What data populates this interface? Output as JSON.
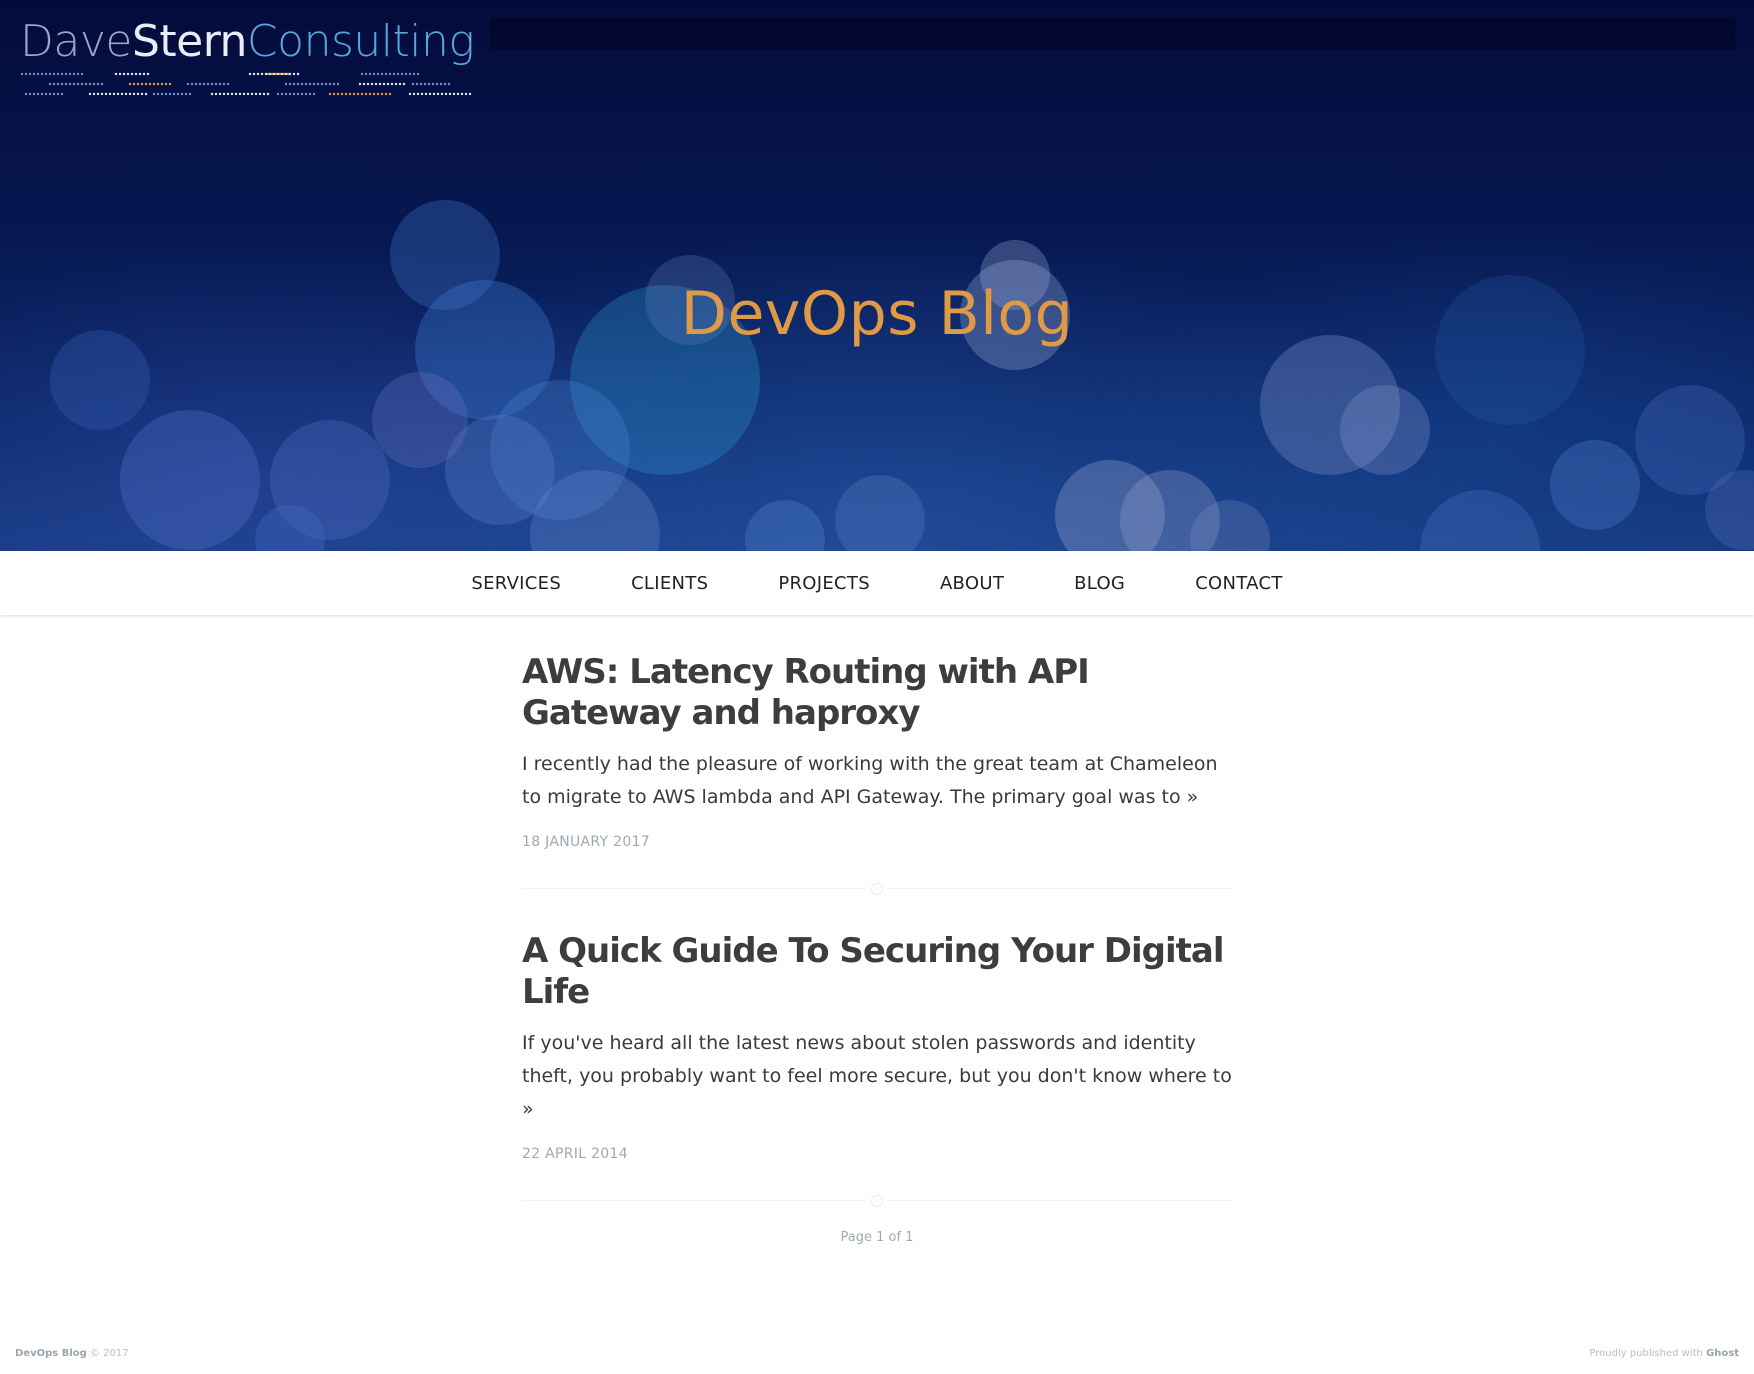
{
  "logo": {
    "first": "Dave",
    "last": "Stern",
    "business": "Consulting"
  },
  "hero": {
    "title": "DevOps Blog"
  },
  "nav": {
    "items": [
      "SERVICES",
      "CLIENTS",
      "PROJECTS",
      "ABOUT",
      "BLOG",
      "CONTACT"
    ]
  },
  "posts": [
    {
      "title": "AWS: Latency Routing with API Gateway and haproxy",
      "excerpt": "I recently had the pleasure of working with the great team at Chameleon to migrate to AWS lambda and API Gateway. The primary goal was to",
      "more": "»",
      "date": "18 JANUARY 2017"
    },
    {
      "title": "A Quick Guide To Securing Your Digital Life",
      "excerpt": "If you've heard all the latest news about stolen passwords and identity theft, you probably want to feel more secure, but you don't know where to",
      "more": "»",
      "date": "22 APRIL 2014"
    }
  ],
  "pagination": {
    "text": "Page 1 of 1"
  },
  "footer": {
    "site_name": "DevOps Blog",
    "copyright": "© 2017",
    "published_prefix": "Proudly published with",
    "platform": "Ghost"
  },
  "colors": {
    "hero_title": "#e09a45",
    "hero_bg_dark": "#030b3a",
    "hero_bg_light": "#173a82",
    "post_title": "#3d3d3d",
    "meta_gray": "#9ea9b3",
    "logo_blue": "#5aa6e0"
  }
}
